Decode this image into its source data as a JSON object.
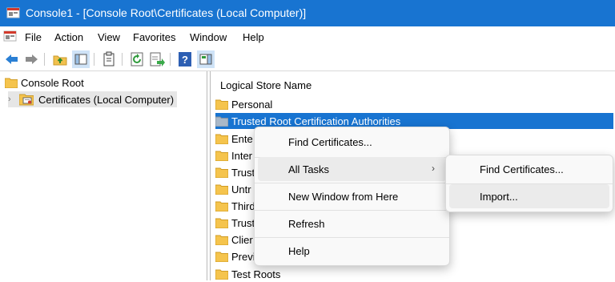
{
  "window": {
    "title": "Console1 - [Console Root\\Certificates (Local Computer)]"
  },
  "menubar": {
    "items": [
      "File",
      "Action",
      "View",
      "Favorites",
      "Window",
      "Help"
    ]
  },
  "toolbar": {
    "buttons": [
      "back-arrow-icon",
      "forward-arrow-icon",
      "up-folder-icon",
      "show-hide-tree-icon",
      "properties-icon",
      "refresh-icon",
      "export-list-icon",
      "help-icon",
      "show-hide-action-pane-icon"
    ]
  },
  "tree": {
    "root": "Console Root",
    "child": "Certificates (Local Computer)"
  },
  "list": {
    "header": "Logical Store Name",
    "rows": [
      "Personal",
      "Trusted Root Certification Authorities",
      "Ente",
      "Inter",
      "Trust",
      "Untr",
      "Third",
      "Trust",
      "Clier",
      "Previ",
      "Test Roots"
    ],
    "selected_index": 1
  },
  "context_menu": {
    "items": [
      "Find Certificates...",
      "All Tasks",
      "New Window from Here",
      "Refresh",
      "Help"
    ],
    "submenu_arrow": "›"
  },
  "submenu": {
    "items": [
      "Find Certificates...",
      "Import..."
    ]
  },
  "colors": {
    "accent": "#1874d1",
    "folder": "#f5c44d"
  }
}
